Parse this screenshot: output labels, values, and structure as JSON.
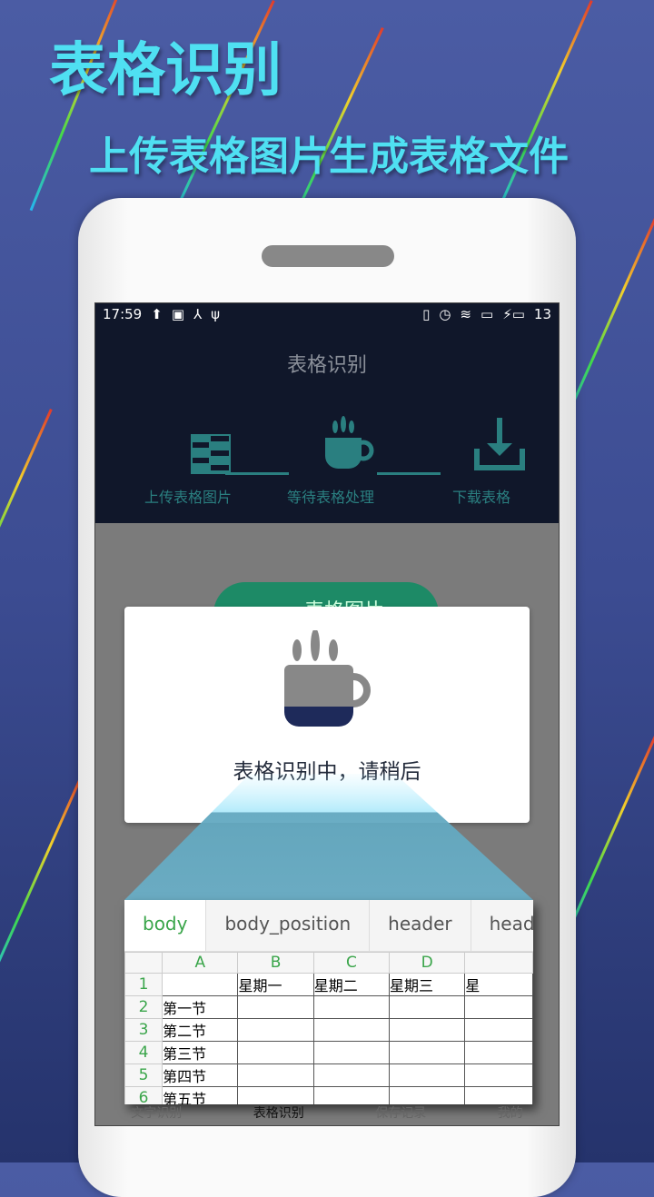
{
  "promo": {
    "title": "表格识别",
    "subtitle": "上传表格图片生成表格文件"
  },
  "status_bar": {
    "time": "17:59",
    "battery": "13"
  },
  "header": {
    "title": "表格识别"
  },
  "steps": [
    {
      "label": "上传表格图片",
      "icon": "table-icon"
    },
    {
      "label": "等待表格处理",
      "icon": "coffee-cup-icon"
    },
    {
      "label": "下载表格",
      "icon": "download-icon"
    }
  ],
  "upload_button": {
    "label": "表格图片"
  },
  "dialog": {
    "message": "表格识别中，请稍后",
    "icon": "coffee-cup-icon"
  },
  "sheet": {
    "tabs": [
      "body",
      "body_position",
      "header",
      "header"
    ],
    "active_tab": "body",
    "columns": [
      "",
      "A",
      "B",
      "C",
      "D",
      ""
    ],
    "rows": [
      [
        "1",
        "",
        "星期一",
        "星期二",
        "星期三",
        "星"
      ],
      [
        "2",
        "第一节",
        "",
        "",
        "",
        ""
      ],
      [
        "3",
        "第二节",
        "",
        "",
        "",
        ""
      ],
      [
        "4",
        "第三节",
        "",
        "",
        "",
        ""
      ],
      [
        "5",
        "第四节",
        "",
        "",
        "",
        ""
      ],
      [
        "6",
        "第五节",
        "",
        "",
        "",
        ""
      ]
    ]
  },
  "bottom_nav": [
    "文字识别",
    "表格识别",
    "保存记录",
    "我的"
  ],
  "colors": {
    "accent": "#2a7f80",
    "header_bg": "#10172a",
    "green": "#3aa54a",
    "cup_fill": "#1e2a5a"
  }
}
